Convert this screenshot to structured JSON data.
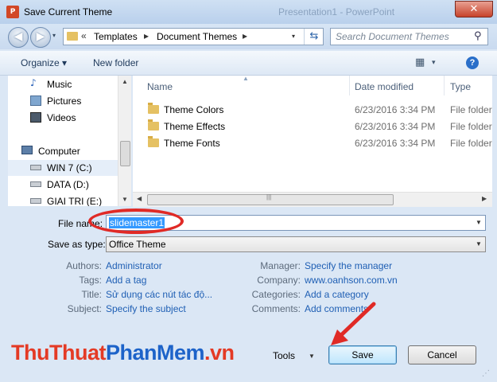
{
  "window": {
    "title": "Save Current Theme",
    "ghost_title": "Presentation1 - PowerPoint",
    "close_glyph": "✕",
    "app_icon_text": "P"
  },
  "nav": {
    "back_glyph": "◀",
    "forward_glyph": "▶",
    "history_glyph": "▾",
    "breadcrumb": {
      "prefix": "«",
      "items": [
        "Templates",
        "Document Themes"
      ],
      "separator": "▸",
      "dropdown_glyph": "▾",
      "refresh_glyph": "⇆"
    },
    "search_placeholder": "Search Document Themes",
    "search_glyph": "⚲"
  },
  "toolbar": {
    "organize": "Organize ▾",
    "new_folder": "New folder",
    "view_glyph": "▦",
    "view_dd": "▾",
    "help": "?"
  },
  "sidebar": {
    "items": [
      {
        "label": "Music",
        "icon": "music-icon"
      },
      {
        "label": "Pictures",
        "icon": "pictures-icon"
      },
      {
        "label": "Videos",
        "icon": "videos-icon"
      },
      {
        "label": "Computer",
        "icon": "computer-icon"
      },
      {
        "label": "WIN 7 (C:)",
        "icon": "drive-icon"
      },
      {
        "label": "DATA (D:)",
        "icon": "drive-icon"
      },
      {
        "label": "GIAI TRI (E:)",
        "icon": "drive-icon"
      }
    ]
  },
  "files": {
    "columns": [
      "Name",
      "Date modified",
      "Type"
    ],
    "sort_glyph": "▲",
    "rows": [
      {
        "name": "Theme Colors",
        "date": "6/23/2016 3:34 PM",
        "type": "File folder"
      },
      {
        "name": "Theme Effects",
        "date": "6/23/2016 3:34 PM",
        "type": "File folder"
      },
      {
        "name": "Theme Fonts",
        "date": "6/23/2016 3:34 PM",
        "type": "File folder"
      }
    ]
  },
  "scroll": {
    "left": "◀",
    "right": "▶",
    "up": "▲",
    "down": "▼",
    "grip": "|||"
  },
  "form": {
    "file_name_label": "File name:",
    "file_name_value": "slidemaster1",
    "save_type_label": "Save as type:",
    "save_type_value": "Office Theme",
    "dd_glyph": "▼"
  },
  "metadata": {
    "left": [
      {
        "label": "Authors:",
        "value": "Administrator"
      },
      {
        "label": "Tags:",
        "value": "Add a tag"
      },
      {
        "label": "Title:",
        "value": "Sử dụng các nút tác độ..."
      },
      {
        "label": "Subject:",
        "value": "Specify the subject"
      }
    ],
    "right": [
      {
        "label": "Manager:",
        "value": "Specify the manager"
      },
      {
        "label": "Company:",
        "value": "www.oanhson.com.vn"
      },
      {
        "label": "Categories:",
        "value": "Add a category"
      },
      {
        "label": "Comments:",
        "value": "Add comments"
      }
    ]
  },
  "footer": {
    "tools_label": "Tools",
    "tools_dd": "▼",
    "save": "Save",
    "cancel": "Cancel",
    "watermark_a": "ThuThuat",
    "watermark_b": "PhanMem",
    "watermark_c": ".vn",
    "resize_glyph": "⋰"
  },
  "colors": {
    "annotation": "#e02a26",
    "link": "#1f5fb4",
    "selection": "#3399ff"
  }
}
